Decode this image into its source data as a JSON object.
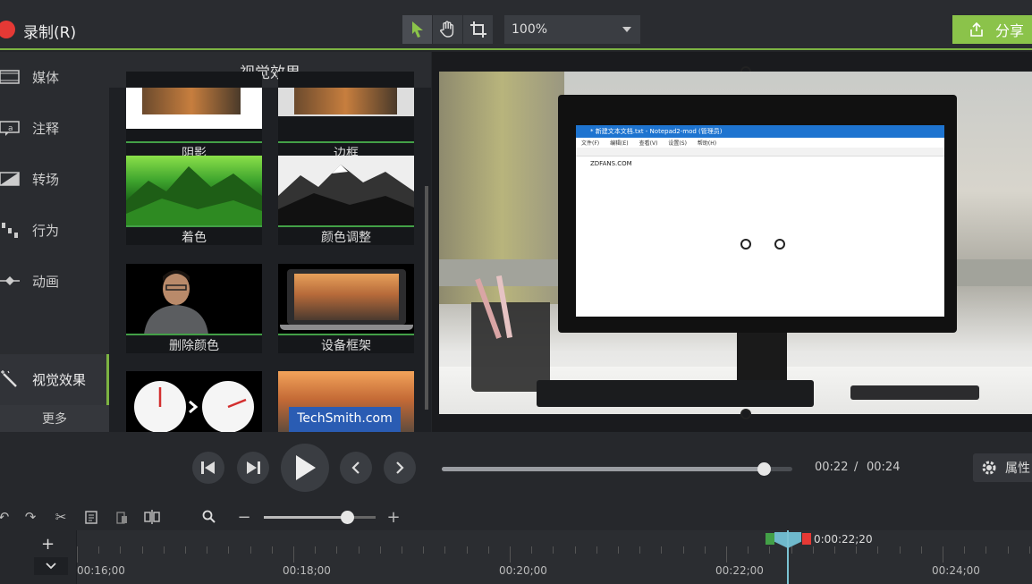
{
  "header": {
    "record_label": "录制(R)",
    "zoom_value": "100%",
    "share_label": "分享",
    "tools": [
      "pointer-icon",
      "hand-icon",
      "crop-icon"
    ]
  },
  "nav": {
    "items": [
      {
        "label": "媒体",
        "icon": "media-icon"
      },
      {
        "label": "注释",
        "icon": "annotation-icon"
      },
      {
        "label": "转场",
        "icon": "transition-icon"
      },
      {
        "label": "行为",
        "icon": "behavior-icon"
      },
      {
        "label": "动画",
        "icon": "animation-icon"
      },
      {
        "label": "视觉效果",
        "icon": "visual-effects-icon"
      }
    ],
    "more_label": "更多"
  },
  "library": {
    "title": "视觉效果",
    "items": [
      {
        "label": "阴影"
      },
      {
        "label": "边框"
      },
      {
        "label": "着色"
      },
      {
        "label": "颜色调整"
      },
      {
        "label": "删除颜色"
      },
      {
        "label": "设备框架"
      },
      {
        "label": ""
      },
      {
        "label": ""
      }
    ],
    "techsmith_text": "TechSmith.com"
  },
  "preview": {
    "notepad_title": "* 新建文本文档.txt - Notepad2-mod (管理员)",
    "notepad_menu": [
      "文件(F)",
      "编辑(E)",
      "查看(V)",
      "设置(S)",
      "帮助(H)"
    ],
    "notepad_text": "ZDFANS.COM"
  },
  "transport": {
    "current_time": "00:22",
    "separator": "/",
    "total_time": "00:24",
    "progress": 0.92,
    "properties_label": "属性"
  },
  "timeline": {
    "zoom_level": 0.74,
    "ticks": [
      "00:16;00",
      "00:18;00",
      "00:20;00",
      "00:22;00",
      "00:24;00"
    ],
    "playhead_label": "0:00:22;20"
  }
}
